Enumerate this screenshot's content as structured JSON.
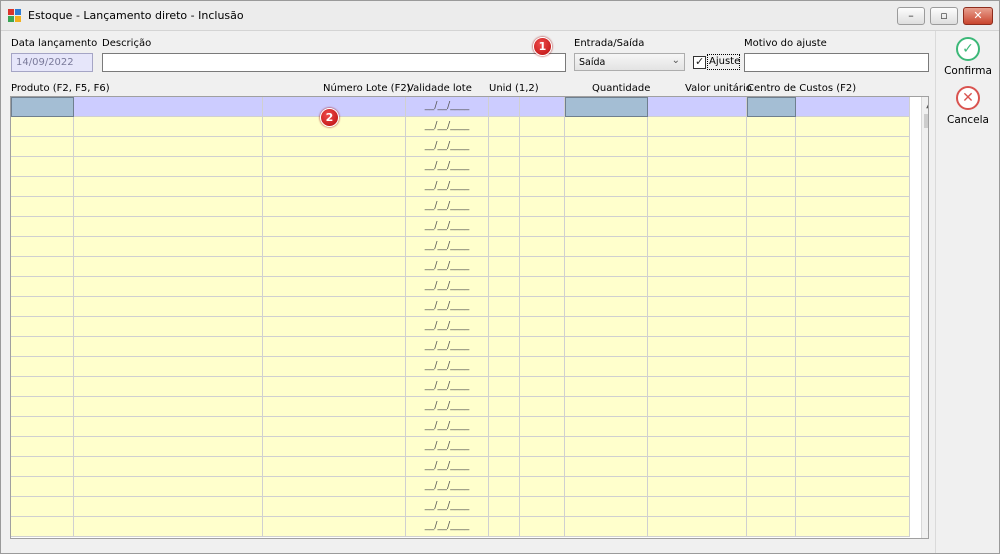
{
  "window": {
    "title": "Estoque - Lançamento direto - Inclusão"
  },
  "header": {
    "data_label": "Data lançamento",
    "data_value": "14/09/2022",
    "descricao_label": "Descrição",
    "descricao_value": "",
    "entrada_label": "Entrada/Saída",
    "entrada_value": "Saída",
    "ajuste_label": "Ajuste",
    "ajuste_checked": true,
    "motivo_label": "Motivo do ajuste",
    "motivo_value": ""
  },
  "markers": [
    "1",
    "2"
  ],
  "grid": {
    "columns": [
      "Produto (F2, F5, F6)",
      "Número Lote (F2)",
      "Validade lote",
      "Unid (1,2)",
      "Quantidade",
      "Valor unitário",
      "Centro de Custos (F2)"
    ],
    "date_mask": "__/__/____",
    "row_count": 22
  },
  "actions": {
    "confirm": "Confirma",
    "cancel": "Cancela"
  },
  "colors": {
    "row_bg": "#ffffcc",
    "selected_row_bg": "#ccccff",
    "selected_key_cell_bg": "#a4bed4",
    "confirm_green": "#3cb878",
    "cancel_red": "#d9534f"
  },
  "icons": [
    "app-icon",
    "minimize-icon",
    "maximize-icon",
    "close-icon",
    "chevron-down-icon",
    "check-icon",
    "x-icon",
    "scroll-up-icon",
    "scroll-down-icon"
  ]
}
